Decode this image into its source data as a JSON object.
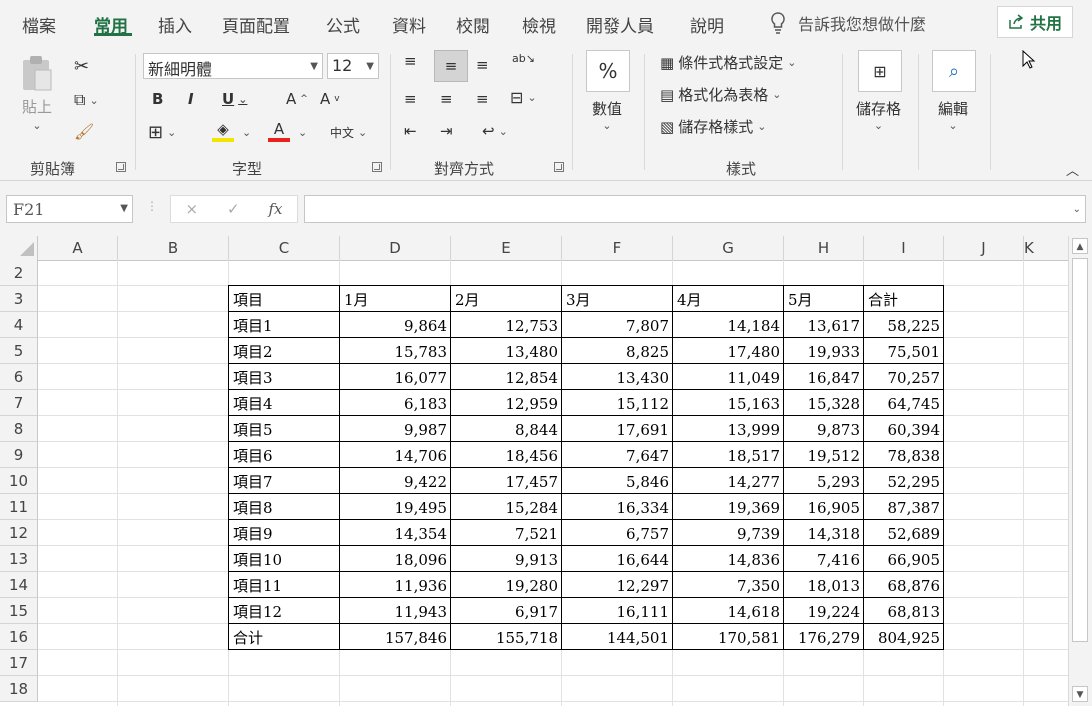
{
  "tabs": [
    "檔案",
    "常用",
    "插入",
    "頁面配置",
    "公式",
    "資料",
    "校閱",
    "檢視",
    "開發人員",
    "說明"
  ],
  "active_tab": "常用",
  "tell_me": "告訴我您想做什麼",
  "share_label": "共用",
  "ribbon": {
    "clipboard": {
      "paste": "貼上",
      "group": "剪貼簿"
    },
    "font": {
      "name": "新細明體",
      "size": "12",
      "group": "字型",
      "bold": "B",
      "italic": "I",
      "underline": "U",
      "grow": "A",
      "shrink": "A",
      "font_color": "A",
      "phonetic": "中文"
    },
    "alignment": {
      "group": "對齊方式"
    },
    "number": {
      "label": "數值",
      "icon": "%"
    },
    "styles": {
      "conditional": "條件式格式設定",
      "as_table": "格式化為表格",
      "cell_styles": "儲存格樣式",
      "group": "樣式"
    },
    "cells": {
      "label": "儲存格"
    },
    "editing": {
      "label": "編輯"
    }
  },
  "formula_bar": {
    "name_box": "F21",
    "cancel": "×",
    "enter": "✓",
    "fx": "fx",
    "formula": ""
  },
  "columns": [
    "A",
    "B",
    "C",
    "D",
    "E",
    "F",
    "G",
    "H",
    "I",
    "J",
    "K"
  ],
  "rows": [
    "2",
    "3",
    "4",
    "5",
    "6",
    "7",
    "8",
    "9",
    "10",
    "11",
    "12",
    "13",
    "14",
    "15",
    "16",
    "17",
    "18"
  ],
  "table": {
    "header": [
      "項目",
      "1月",
      "2月",
      "3月",
      "4月",
      "5月",
      "合計"
    ],
    "rows": [
      [
        "項目1",
        "9,864",
        "12,753",
        "7,807",
        "14,184",
        "13,617",
        "58,225"
      ],
      [
        "項目2",
        "15,783",
        "13,480",
        "8,825",
        "17,480",
        "19,933",
        "75,501"
      ],
      [
        "項目3",
        "16,077",
        "12,854",
        "13,430",
        "11,049",
        "16,847",
        "70,257"
      ],
      [
        "項目4",
        "6,183",
        "12,959",
        "15,112",
        "15,163",
        "15,328",
        "64,745"
      ],
      [
        "項目5",
        "9,987",
        "8,844",
        "17,691",
        "13,999",
        "9,873",
        "60,394"
      ],
      [
        "項目6",
        "14,706",
        "18,456",
        "7,647",
        "18,517",
        "19,512",
        "78,838"
      ],
      [
        "項目7",
        "9,422",
        "17,457",
        "5,846",
        "14,277",
        "5,293",
        "52,295"
      ],
      [
        "項目8",
        "19,495",
        "15,284",
        "16,334",
        "19,369",
        "16,905",
        "87,387"
      ],
      [
        "項目9",
        "14,354",
        "7,521",
        "6,757",
        "9,739",
        "14,318",
        "52,689"
      ],
      [
        "項目10",
        "18,096",
        "9,913",
        "16,644",
        "14,836",
        "7,416",
        "66,905"
      ],
      [
        "項目11",
        "11,936",
        "19,280",
        "12,297",
        "7,350",
        "18,013",
        "68,876"
      ],
      [
        "項目12",
        "11,943",
        "6,917",
        "16,111",
        "14,618",
        "19,224",
        "68,813"
      ],
      [
        "合计",
        "157,846",
        "155,718",
        "144,501",
        "170,581",
        "176,279",
        "804,925"
      ]
    ]
  },
  "colors": {
    "accent": "#217346",
    "font_color_bar": "#e8231b",
    "highlight_bar": "#f2e500"
  }
}
